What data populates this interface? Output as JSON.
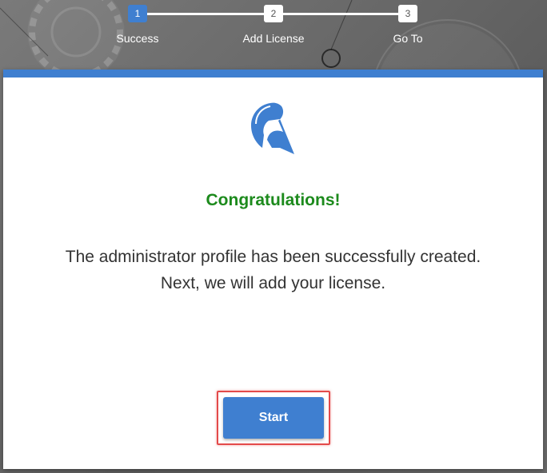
{
  "stepper": {
    "steps": [
      {
        "number": "1",
        "label": "Success"
      },
      {
        "number": "2",
        "label": "Add License"
      },
      {
        "number": "3",
        "label": "Go To"
      }
    ],
    "active_step": 1
  },
  "card": {
    "logo_icon": "spartan-helmet-icon",
    "title": "Congratulations!",
    "message_line1": "The administrator profile has been successfully created.",
    "message_line2": "Next, we will add your license.",
    "start_label": "Start"
  },
  "colors": {
    "accent": "#3f7fd0",
    "success": "#1c8a1c",
    "highlight": "#e34a4a"
  }
}
